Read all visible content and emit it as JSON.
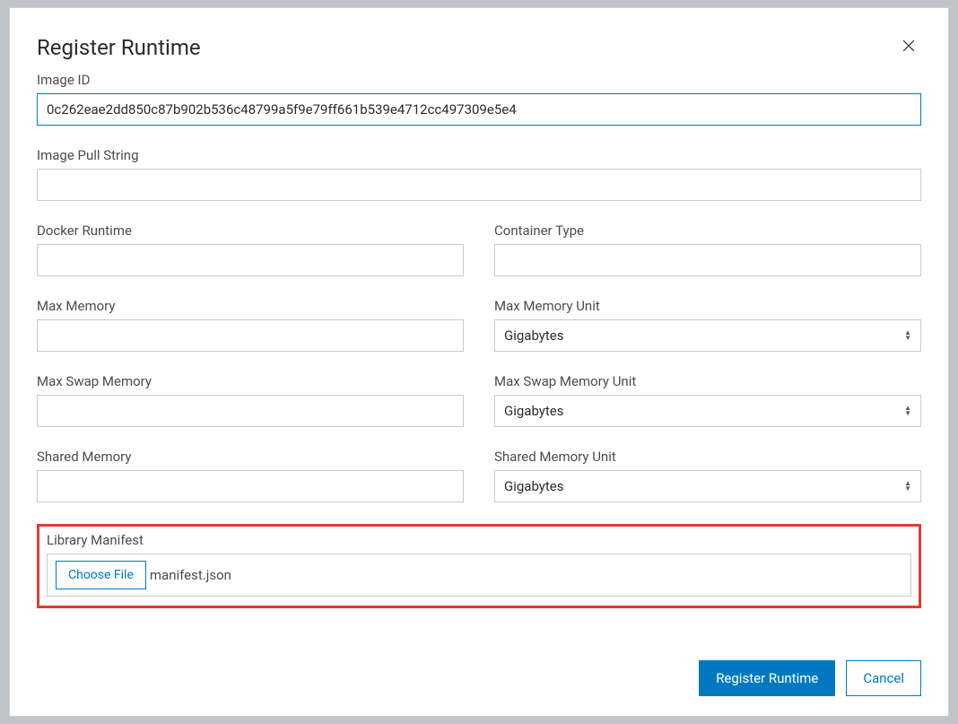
{
  "modal": {
    "title": "Register Runtime",
    "form": {
      "image_id": {
        "label": "Image ID",
        "value": "0c262eae2dd850c87b902b536c48799a5f9e79ff661b539e4712cc497309e5e4"
      },
      "image_pull_string": {
        "label": "Image Pull String",
        "value": ""
      },
      "docker_runtime": {
        "label": "Docker Runtime",
        "value": ""
      },
      "container_type": {
        "label": "Container Type",
        "value": ""
      },
      "max_memory": {
        "label": "Max Memory",
        "value": ""
      },
      "max_memory_unit": {
        "label": "Max Memory Unit",
        "selected": "Gigabytes"
      },
      "max_swap_memory": {
        "label": "Max Swap Memory",
        "value": ""
      },
      "max_swap_memory_unit": {
        "label": "Max Swap Memory Unit",
        "selected": "Gigabytes"
      },
      "shared_memory": {
        "label": "Shared Memory",
        "value": ""
      },
      "shared_memory_unit": {
        "label": "Shared Memory Unit",
        "selected": "Gigabytes"
      },
      "library_manifest": {
        "label": "Library Manifest",
        "choose_label": "Choose File",
        "filename": "manifest.json"
      }
    },
    "actions": {
      "primary": "Register Runtime",
      "cancel": "Cancel"
    }
  }
}
